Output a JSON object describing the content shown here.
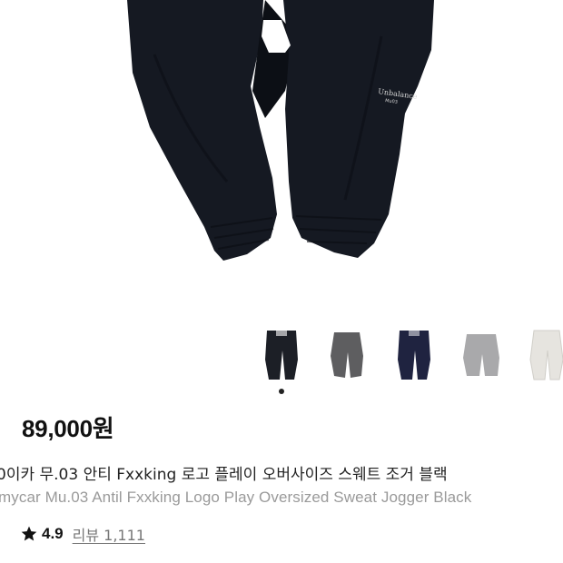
{
  "product": {
    "price": "89,000원",
    "title_ko": "0이카 무.03 안티 Fxxking 로고 플레이 오버사이즈 스웨트 조거 블랙",
    "title_en": "mycar Mu.03 Antil Fxxking Logo Play Oversized Sweat Jogger Black",
    "logo_text_line1": "Unbalance",
    "logo_text_line2": "Mu03"
  },
  "rating": {
    "icon": "star-icon",
    "value": "4.9",
    "review_label": "리뷰 1,111"
  },
  "gallery": {
    "selected_index": 0,
    "thumbnails": [
      {
        "color_name": "black",
        "color": "#1c1f26"
      },
      {
        "color_name": "charcoal",
        "color": "#5e5e60"
      },
      {
        "color_name": "navy",
        "color": "#1f2340"
      },
      {
        "color_name": "grey",
        "color": "#a9a9ab"
      },
      {
        "color_name": "ivory",
        "color": "#e6e4df"
      }
    ]
  },
  "colors": {
    "pants_main": "#151922",
    "pants_shadow": "#0c0f15",
    "price_text": "#111111",
    "subtitle_text": "#9a9a9a"
  }
}
